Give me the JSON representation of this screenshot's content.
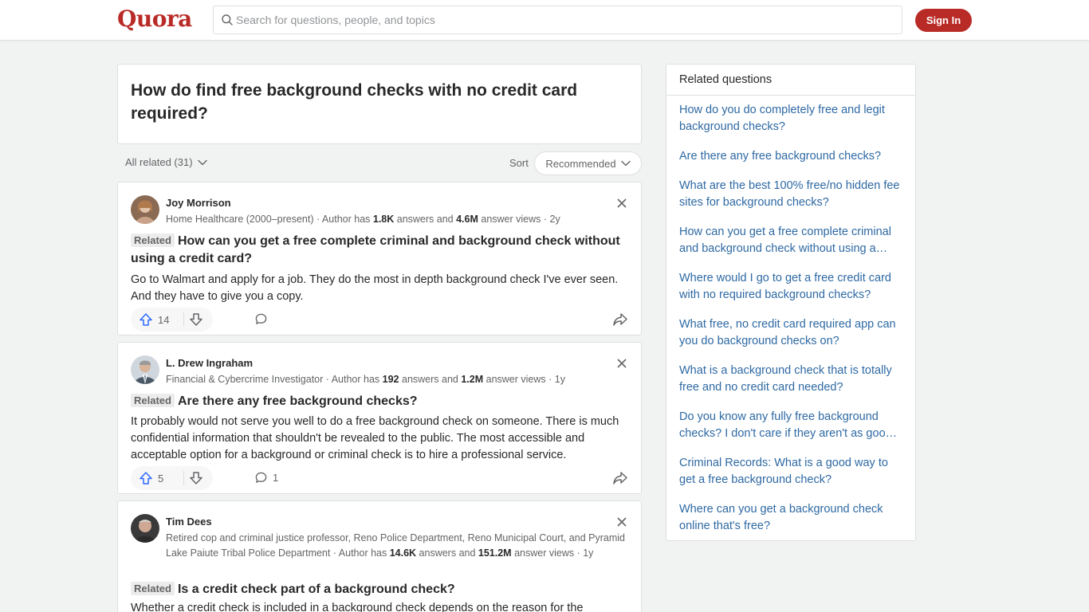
{
  "header": {
    "logo": "Quora",
    "search_placeholder": "Search for questions, people, and topics",
    "signin_label": "Sign In"
  },
  "question": {
    "title": "How do find free background checks with no credit card required?"
  },
  "filter": {
    "all_related": "All related (31)",
    "sort_label": "Sort",
    "sort_value": "Recommended"
  },
  "answers": [
    {
      "name": "Joy Morrison",
      "cred_prefix": "Home Healthcare (2000–present) · Author has ",
      "answers_count": "1.8K",
      "cred_mid": " answers and ",
      "views_count": "4.6M",
      "cred_suffix": " answer views · 2y",
      "related_tag": "Related",
      "related_question": "How can you get a free complete criminal and background check without using a credit card?",
      "body": "Go to Walmart and apply for a job. They do the most in depth background check I've ever seen. And they have to give you a copy.",
      "upvotes": "14",
      "comments": ""
    },
    {
      "name": "L. Drew Ingraham",
      "cred_prefix": "Financial & Cybercrime Investigator · Author has ",
      "answers_count": "192",
      "cred_mid": " answers and ",
      "views_count": "1.2M",
      "cred_suffix": " answer views · 1y",
      "related_tag": "Related",
      "related_question": "Are there any free background checks?",
      "body": "It probably would not serve you well to do a free background check on someone. There is much confidential information that shouldn't be revealed to the public. The most accessible and acceptable option for a background or criminal check is to hire a professional service.",
      "upvotes": "5",
      "comments": "1"
    },
    {
      "name": "Tim Dees",
      "cred_prefix": "Retired cop and criminal justice professor, Reno Police Department, Reno Municipal Court, and Pyramid Lake Paiute Tribal Police Department · Author has ",
      "answers_count": "14.6K",
      "cred_mid": " answers and ",
      "views_count": "151.2M",
      "cred_suffix": " answer views · 1y",
      "related_tag": "Related",
      "related_question": "Is a credit check part of a background check?",
      "body": "Whether a credit check is included in a background check depends on the reason for the",
      "upvotes": "",
      "comments": ""
    }
  ],
  "sidebar": {
    "title": "Related questions",
    "items": [
      "How do you do completely free and legit background checks?",
      "Are there any free background checks?",
      "What are the best 100% free/no hidden fee sites for background checks?",
      "How can you get a free complete criminal and background check without using a…",
      "Where would I go to get a free credit card with no required background checks?",
      "What free, no credit card required app can you do background checks on?",
      "What is a background check that is totally free and no credit card needed?",
      "Do you know any fully free background checks? I don't care if they aren't as goo…",
      "Criminal Records: What is a good way to get a free background check?",
      "Where can you get a background check online that's free?"
    ]
  },
  "colors": {
    "brand": "#b92b27",
    "link": "#2e69a3",
    "background": "#f1f2f2"
  }
}
